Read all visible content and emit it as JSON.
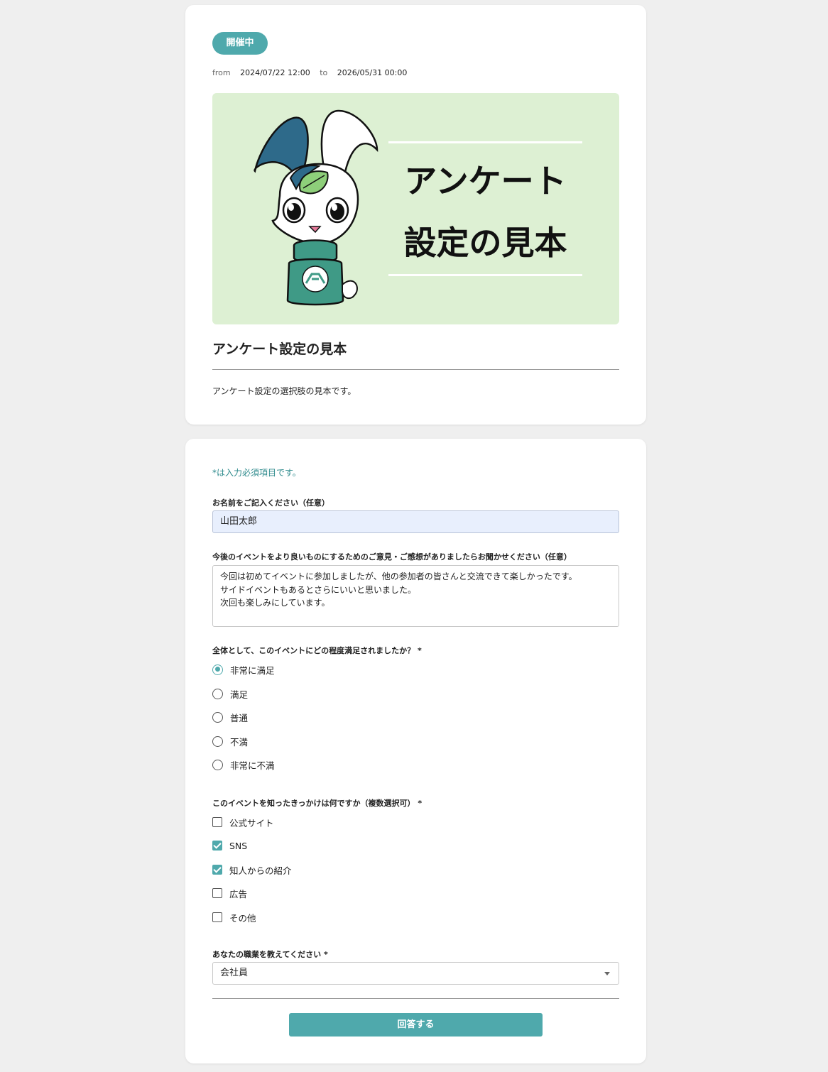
{
  "event": {
    "status": "開催中",
    "period": {
      "from_label": "from",
      "from": "2024/07/22 12:00",
      "to_label": "to",
      "to": "2026/05/31 00:00"
    },
    "banner": {
      "line1": "アンケート",
      "line2": "設定の見本"
    },
    "title": "アンケート設定の見本",
    "description": "アンケート設定の選択肢の見本です。"
  },
  "form": {
    "required_note": "*は入力必須項目です。",
    "q1": {
      "label": "お名前をご記入ください（任意）",
      "value": "山田太郎"
    },
    "q2": {
      "label": "今後のイベントをより良いものにするためのご意見・ご感想がありましたらお聞かせください（任意）",
      "value": "今回は初めてイベントに参加しましたが、他の参加者の皆さんと交流できて楽しかったです。\nサイドイベントもあるとさらにいいと思いました。\n次回も楽しみにしています。"
    },
    "q3": {
      "label": "全体として、このイベントにどの程度満足されましたか？ *",
      "options": [
        "非常に満足",
        "満足",
        "普通",
        "不満",
        "非常に不満"
      ],
      "selected": "非常に満足"
    },
    "q4": {
      "label": "このイベントを知ったきっかけは何ですか（複数選択可） *",
      "options": [
        "公式サイト",
        "SNS",
        "知人からの紹介",
        "広告",
        "その他"
      ],
      "checked": [
        "SNS",
        "知人からの紹介"
      ]
    },
    "q5": {
      "label": "あなたの職業を教えてください *",
      "value": "会社員"
    },
    "submit_label": "回答する"
  },
  "colors": {
    "accent": "#4fa9ac",
    "banner_bg": "#ddf0d3",
    "page_bg": "#efefef"
  }
}
